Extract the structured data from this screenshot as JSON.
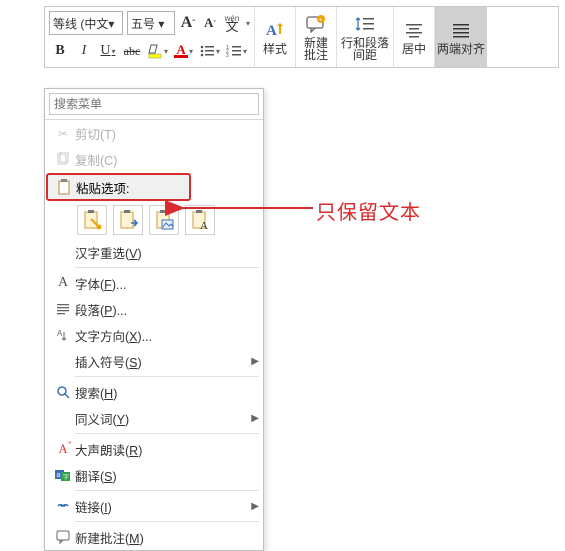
{
  "ribbon": {
    "font_name": "等线 (中文▾",
    "font_size": "五号 ▾",
    "grow": "A",
    "shrink": "A",
    "phonetic": "wén",
    "bold": "B",
    "italic": "I",
    "underline": "U",
    "strike": "abc",
    "styles": "样式",
    "new_comment_l1": "新建",
    "new_comment_l2": "批注",
    "spacing_l1": "行和段落",
    "spacing_l2": "间距",
    "center": "居中",
    "justify": "两端对齐"
  },
  "menu": {
    "search_placeholder": "搜索菜单",
    "cut": "剪切(T)",
    "copy": "复制(C)",
    "paste_header": "粘贴选项:",
    "hanzi_reselect": "汉字重选(V)",
    "hz_u": "V",
    "font": "字体(F)...",
    "font_u": "F",
    "paragraph": "段落(P)...",
    "para_u": "P",
    "text_dir": "文字方向(X)...",
    "dir_u": "X",
    "insert_symbol": "插入符号(S)",
    "sym_u": "S",
    "search": "搜索(H)",
    "search_u": "H",
    "synonyms": "同义词(Y)",
    "syn_u": "Y",
    "read_aloud": "大声朗读(R)",
    "read_u": "R",
    "translate": "翻译(S)",
    "trans_u": "S",
    "link": "链接(I)",
    "link_u": "I",
    "new_comment": "新建批注(M)",
    "comment_u": "M"
  },
  "annotation": {
    "text": "只保留文本"
  }
}
